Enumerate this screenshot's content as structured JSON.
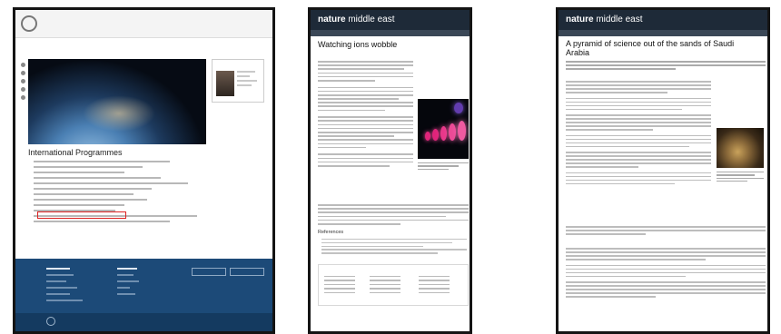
{
  "panel1": {
    "title": "International Programmes"
  },
  "panel2": {
    "brand": {
      "word1": "nature",
      "word2": "middle east"
    },
    "title": "Watching ions wobble",
    "references_heading": "References"
  },
  "panel3": {
    "brand": {
      "word1": "nature",
      "word2": "middle east"
    },
    "title": "A pyramid of science out of the sands of Saudi Arabia"
  },
  "colors": {
    "nature_header": "#1e2a38",
    "footer_blue": "#1c4a78",
    "highlight_red": "#dd2222"
  }
}
